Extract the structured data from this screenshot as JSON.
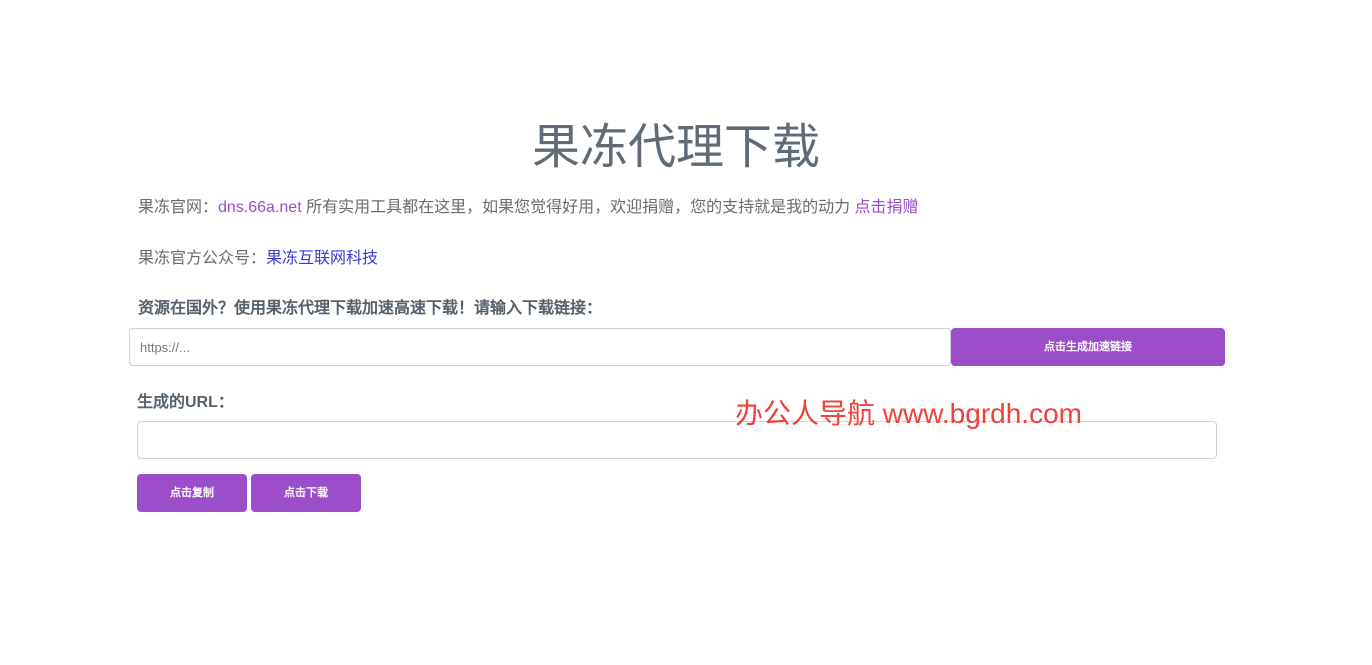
{
  "page": {
    "title": "果冻代理下载"
  },
  "info": {
    "site_prefix": "果冻官网：",
    "site_link": "dns.66a.net",
    "site_text": " 所有实用工具都在这里，如果您觉得好用，欢迎捐赠，您的支持就是我的动力 ",
    "donate_link": "点击捐赠",
    "wechat_prefix": "果冻官方公众号：",
    "wechat_link": "果冻互联网科技"
  },
  "form": {
    "prompt_label": "资源在国外？使用果冻代理下载加速高速下载！请输入下载链接：",
    "url_placeholder": "https://...",
    "generate_button": "点击生成加速链接",
    "result_label": "生成的URL：",
    "result_value": "",
    "copy_button": "点击复制",
    "download_button": "点击下载"
  },
  "watermark": {
    "text": "办公人导航  www.bgrdh.com"
  },
  "colors": {
    "accent": "#9b4dca",
    "title": "#5f6b77",
    "watermark": "#f0413a",
    "link_blue": "#3b3bd6"
  }
}
